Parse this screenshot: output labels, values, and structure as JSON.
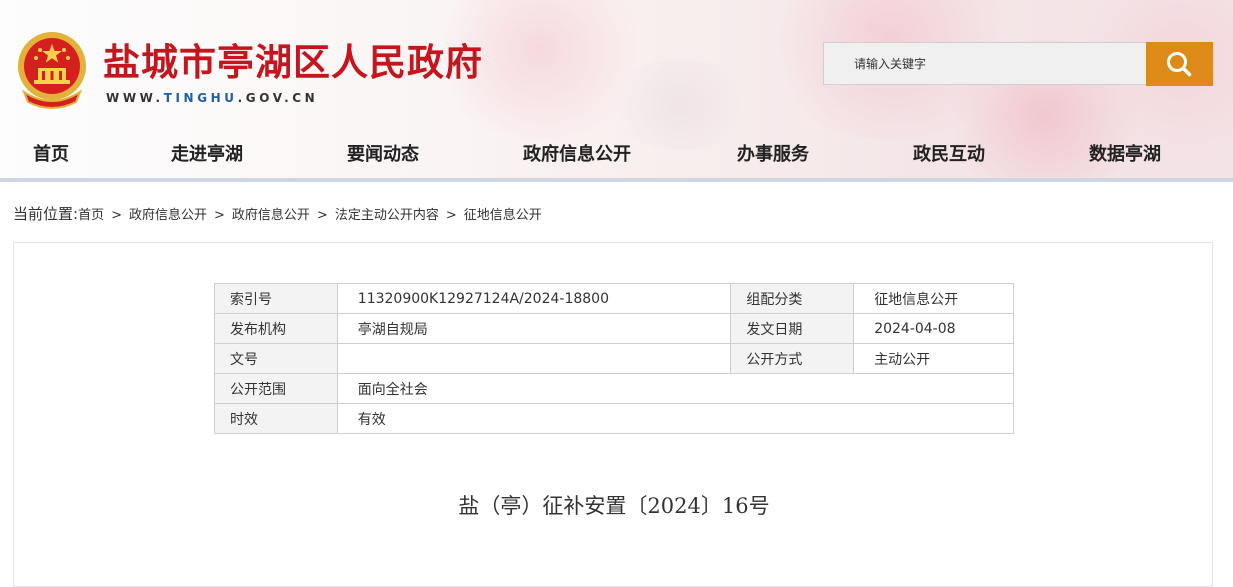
{
  "header": {
    "site_title": "盐城市亭湖区人民政府",
    "url_prefix": "WWW.",
    "url_highlight": "TINGHU",
    "url_suffix": ".GOV.CN",
    "emblem_icon": "national-emblem-icon"
  },
  "search": {
    "placeholder": "请输入关键字",
    "button_icon": "search-icon",
    "button_color": "#de8a18"
  },
  "nav": {
    "items": [
      "首页",
      "走进亭湖",
      "要闻动态",
      "政府信息公开",
      "办事服务",
      "政民互动",
      "数据亭湖"
    ]
  },
  "breadcrumb": {
    "lead": "当前位置:",
    "items": [
      "首页",
      "政府信息公开",
      "政府信息公开",
      "法定主动公开内容",
      "征地信息公开"
    ],
    "separator": ">"
  },
  "meta": {
    "index_label": "索引号",
    "index_value": "11320900K12927124A/2024-18800",
    "category_label": "组配分类",
    "category_value": "征地信息公开",
    "publisher_label": "发布机构",
    "publisher_value": "亭湖自规局",
    "date_label": "发文日期",
    "date_value": "2024-04-08",
    "docno_label": "文号",
    "docno_value": "",
    "method_label": "公开方式",
    "method_value": "主动公开",
    "scope_label": "公开范围",
    "scope_value": "面向全社会",
    "validity_label": "时效",
    "validity_value": "有效"
  },
  "document": {
    "title": "盐（亭）征补安置〔2024〕16号"
  },
  "colors": {
    "brand_red": "#c4161c",
    "url_blue": "#1e5fa8",
    "accent_orange": "#de8a18"
  }
}
